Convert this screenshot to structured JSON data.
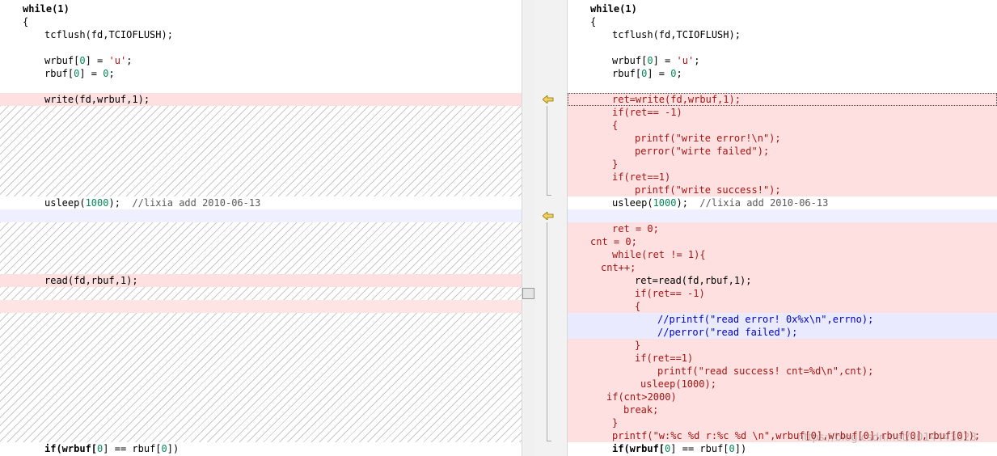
{
  "watermark": "https://blog.csdn.net/u014443028",
  "colors": {
    "changed": "#ffe0e0",
    "blue": "#eaeaff",
    "arrow": "#e8c84a"
  },
  "left": {
    "l0": "while(1)",
    "l1": "{",
    "l2": "tcflush(fd,TCIOFLUSH);",
    "l4a": "wrbuf[",
    "l4b": "0",
    "l4c": "] = ",
    "l4d": "'u'",
    "l4e": ";",
    "l5a": "rbuf[",
    "l5b": "0",
    "l5c": "] = ",
    "l5d": "0",
    "l5e": ";",
    "l7": "write(fd,wrbuf,1);",
    "l15a": "usleep(",
    "l15b": "1000",
    "l15c": ");  ",
    "l15d": "//lixia add 2010-06-13",
    "l21": "read(fd,rbuf,1);",
    "l34a": "if(wrbuf[",
    "l34b": "0",
    "l34c": "] == rbuf[",
    "l34d": "0",
    "l34e": "])"
  },
  "right": {
    "r0": "while(1)",
    "r1": "{",
    "r2": "tcflush(fd,TCIOFLUSH);",
    "r4a": "wrbuf[",
    "r4b": "0",
    "r4c": "] = ",
    "r4d": "'u'",
    "r4e": ";",
    "r5a": "rbuf[",
    "r5b": "0",
    "r5c": "] = ",
    "r5d": "0",
    "r5e": ";",
    "r7": "ret=write(fd,wrbuf,1);",
    "r8": "if(ret== -1)",
    "r9": "{",
    "r10": "printf(\"write error!\\n\");",
    "r11": "perror(\"wirte failed\");",
    "r12": "}",
    "r13": "if(ret==1)",
    "r14": "printf(\"write success!\");",
    "r15a": "usleep(",
    "r15b": "1000",
    "r15c": ");  ",
    "r15d": "//lixia add 2010-06-13",
    "r17": "ret = 0;",
    "r18": "cnt = 0;",
    "r19": "while(ret != 1){",
    "r20": "cnt++;",
    "r21": "ret=read(fd,rbuf,1);",
    "r22": "if(ret== -1)",
    "r23": "{",
    "r24": "//printf(\"read error! 0x%x\\n\",errno);",
    "r25": "//perror(\"read failed\");",
    "r26": "}",
    "r27": "if(ret==1)",
    "r28": "printf(\"read success! cnt=%d\\n\",cnt);",
    "r29": "usleep(1000);",
    "r30": "if(cnt>2000)",
    "r31": "break;",
    "r32": "}",
    "r33": "printf(\"w:%c %d r:%c %d \\n\",wrbuf[0],wrbuf[0],rbuf[0],rbuf[0]);",
    "r34a": "if(wrbuf[",
    "r34b": "0",
    "r34c": "] == rbuf[",
    "r34d": "0",
    "r34e": "])"
  }
}
